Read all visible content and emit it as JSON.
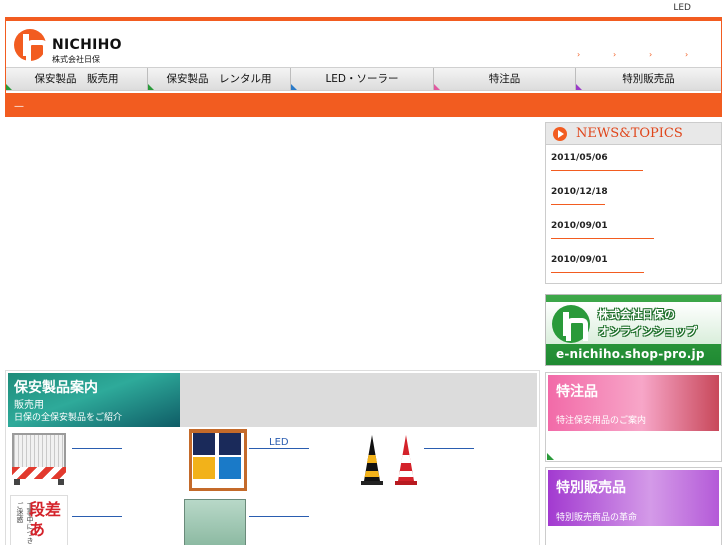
{
  "topbar": {
    "led_link": "LED"
  },
  "brand": {
    "name": "NICHIHO",
    "sub": "株式会社日保"
  },
  "header": {
    "arrows": [
      "›",
      "›",
      "›",
      "›"
    ]
  },
  "nav": {
    "tabs": [
      {
        "label": "保安製品　販売用",
        "corner_color": "#2a9a3a"
      },
      {
        "label": "保安製品　レンタル用",
        "corner_color": "#2a9a3a"
      },
      {
        "label": "LED・ソーラー",
        "corner_color": "#2a7ac8"
      },
      {
        "label": "特注品",
        "corner_color": "#e05aa0"
      },
      {
        "label": "特別販売品",
        "corner_color": "#9a3ac8"
      }
    ]
  },
  "subbar": {
    "text": "—"
  },
  "news": {
    "title": "NEWS&TOPICS",
    "items": [
      {
        "date": "2011/05/06"
      },
      {
        "date": "2010/12/18"
      },
      {
        "date": "2010/09/01"
      },
      {
        "date": "2010/09/01"
      }
    ]
  },
  "shop_banner": {
    "line1": "株式会社日保の",
    "line2": "オンラインショップ",
    "url": "e-nichiho.shop-pro.jp"
  },
  "side_special": {
    "title": "特注品",
    "subtitle": "特注保安用品のご案内"
  },
  "side_sale": {
    "title": "特別販売品",
    "subtitle": "特別販売商品の革命"
  },
  "catalog": {
    "title": "保安製品案内",
    "sub1": "販売用",
    "sub2": "日保の全保安製品をご紹介",
    "products": [
      {
        "link": "　　　　　"
      },
      {
        "link": "　　LED　　"
      },
      {
        "link": "　　　　　"
      },
      {
        "link": "　　　　　"
      },
      {
        "link": "　　　　　　"
      }
    ],
    "sign_vertical": "工事中につきご迷惑",
    "sign_big": "段差あ"
  },
  "colors": {
    "accent": "#f25c20",
    "green": "#2a9a3a",
    "link": "#2a5db0"
  }
}
